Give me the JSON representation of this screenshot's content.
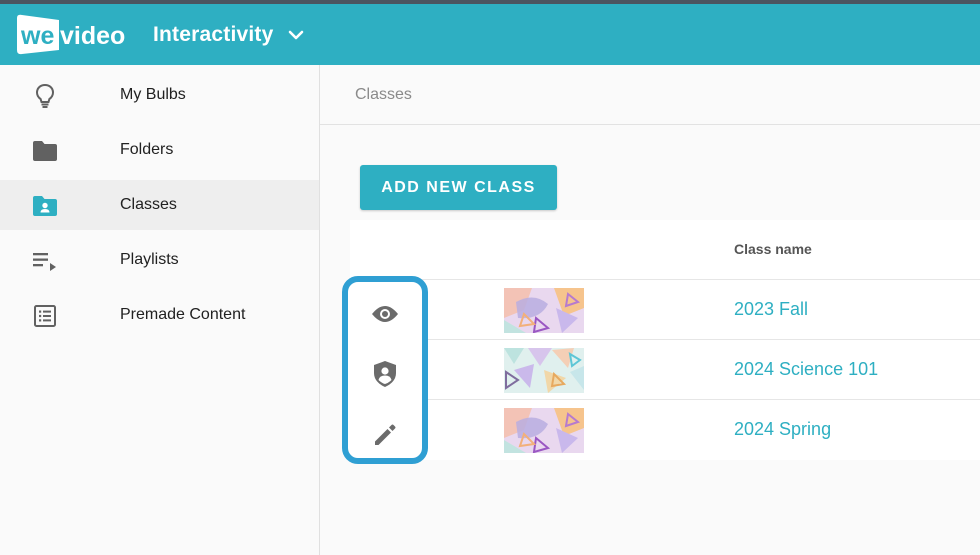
{
  "header": {
    "logo_text": "wevideo",
    "app_title": "Interactivity",
    "colors": {
      "brand": "#2eafc2",
      "top_strip": "#4b5560"
    }
  },
  "sidebar": {
    "items": [
      {
        "label": "My Bulbs",
        "icon": "lightbulb-icon",
        "active": false
      },
      {
        "label": "Folders",
        "icon": "folder-icon",
        "active": false
      },
      {
        "label": "Classes",
        "icon": "class-folder-icon",
        "active": true
      },
      {
        "label": "Playlists",
        "icon": "playlist-icon",
        "active": false
      },
      {
        "label": "Premade Content",
        "icon": "list-alt-icon",
        "active": false
      }
    ]
  },
  "main": {
    "breadcrumb": "Classes",
    "add_button_label": "ADD NEW CLASS",
    "table": {
      "columns": [
        "",
        "",
        "Class name"
      ],
      "rows": [
        {
          "name": "2023 Fall",
          "thumbnail": "pastel-triangle-pattern"
        },
        {
          "name": "2024 Science 101",
          "thumbnail": "pastel-triangle-pattern"
        },
        {
          "name": "2024 Spring",
          "thumbnail": "pastel-triangle-pattern"
        }
      ]
    },
    "actions": [
      {
        "icon": "eye-icon"
      },
      {
        "icon": "shield-user-icon"
      },
      {
        "icon": "pencil-icon"
      }
    ],
    "colors": {
      "link": "#2eafc2",
      "highlight_border": "#2f9fd3"
    }
  }
}
